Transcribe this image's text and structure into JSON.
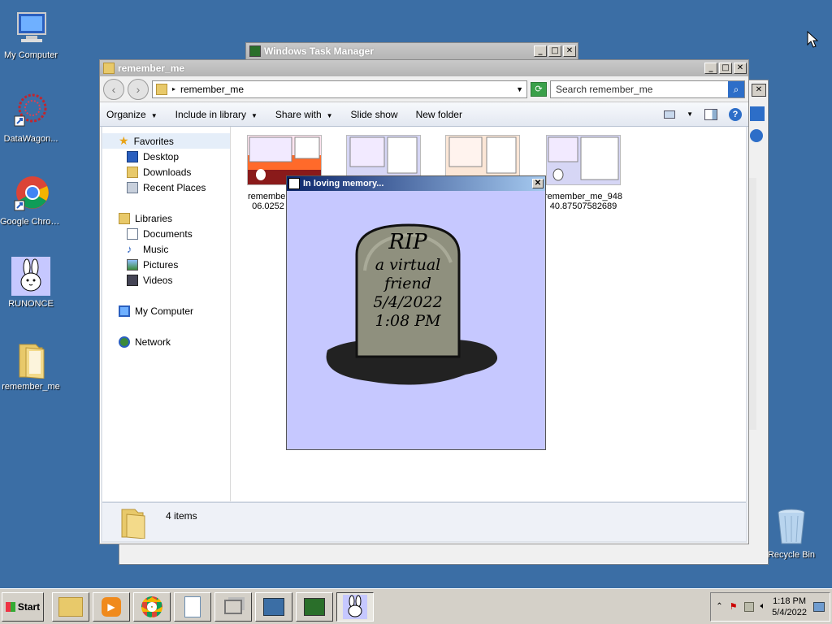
{
  "desktop": {
    "icons": [
      {
        "label": "My Computer"
      },
      {
        "label": "DataWagon..."
      },
      {
        "label": "Google Chrome"
      },
      {
        "label": "RUNONCE"
      },
      {
        "label": "remember_me"
      },
      {
        "label": "Recycle Bin"
      }
    ]
  },
  "task_manager": {
    "title": "Windows Task Manager"
  },
  "explorer": {
    "title": "remember_me",
    "address": {
      "path": "remember_me"
    },
    "search": {
      "placeholder": "Search remember_me"
    },
    "commands": {
      "organize": "Organize",
      "include_in_library": "Include in library",
      "share_with": "Share with",
      "slide_show": "Slide show",
      "new_folder": "New folder"
    },
    "nav": {
      "favorites": "Favorites",
      "desktop": "Desktop",
      "downloads": "Downloads",
      "recent_places": "Recent Places",
      "libraries": "Libraries",
      "documents": "Documents",
      "music": "Music",
      "pictures": "Pictures",
      "videos": "Videos",
      "my_computer": "My Computer",
      "network": "Network"
    },
    "files": [
      {
        "line1": "remember",
        "line2": "06.0252"
      },
      {
        "line1": "",
        "line2": ""
      },
      {
        "line1": "",
        "line2": ""
      },
      {
        "line1": "remember_me_948",
        "line2": "40.87507582689"
      }
    ],
    "status": {
      "count": "4 items"
    }
  },
  "popup": {
    "title": "In loving memory...",
    "tombstone": {
      "line1": "RIP",
      "line2": "a virtual",
      "line3": "friend",
      "line4": "5/4/2022",
      "line5": "1:08 PM"
    }
  },
  "taskbar": {
    "start_label": "Start",
    "clock_time": "1:18 PM",
    "clock_date": "5/4/2022"
  },
  "colors": {
    "desktop_bg": "#3b6ea5",
    "popup_bg": "#c6c8ff",
    "title_active": "#0a246a"
  }
}
